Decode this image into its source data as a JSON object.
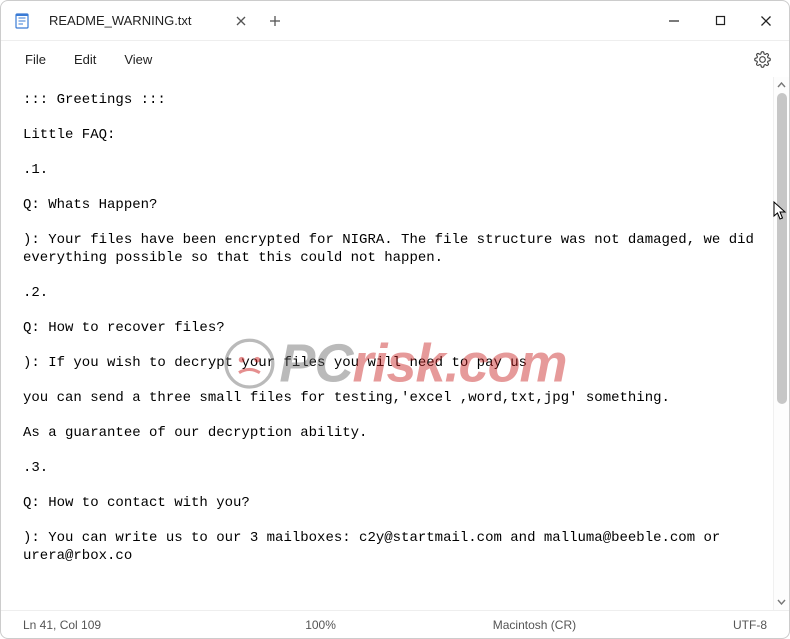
{
  "titlebar": {
    "tab_title": "README_WARNING.txt"
  },
  "menubar": {
    "file": "File",
    "edit": "Edit",
    "view": "View"
  },
  "content": {
    "lines": [
      "::: Greetings :::",
      "Little FAQ:",
      ".1.",
      "Q: Whats Happen?",
      "): Your files have been encrypted for NIGRA. The file structure was not damaged, we did everything possible so that this could not happen.",
      ".2.",
      "Q: How to recover files?",
      "): If you wish to decrypt your files you will need to pay us",
      "you can send a three small files for testing,'excel ,word,txt,jpg' something.",
      "As a guarantee of our decryption ability.",
      ".3.",
      "Q: How to contact with you?",
      "): You can write us to our 3 mailboxes: c2y@startmail.com and malluma@beeble.com or urera@rbox.co"
    ]
  },
  "statusbar": {
    "position": "Ln 41, Col 109",
    "zoom": "100%",
    "line_ending": "Macintosh (CR)",
    "encoding": "UTF-8"
  },
  "watermark": {
    "prefix": "PC",
    "suffix": "risk.com"
  }
}
